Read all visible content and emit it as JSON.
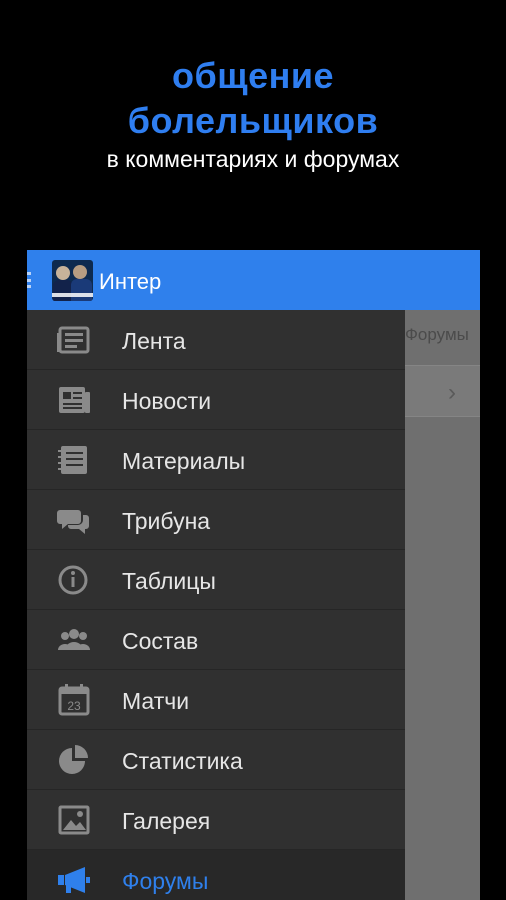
{
  "promo": {
    "line1": "общение",
    "line2": "болельщиков",
    "subtitle": "в комментариях и форумах"
  },
  "appbar": {
    "title": "Интер",
    "logo_icon": "team-logo"
  },
  "behind": {
    "tab_label": "Форумы",
    "chevron_icon": "chevron-right-icon"
  },
  "menu": [
    {
      "label": "Лента",
      "icon": "feed-icon"
    },
    {
      "label": "Новости",
      "icon": "news-icon"
    },
    {
      "label": "Материалы",
      "icon": "articles-icon"
    },
    {
      "label": "Трибуна",
      "icon": "chat-bubbles-icon"
    },
    {
      "label": "Таблицы",
      "icon": "info-icon"
    },
    {
      "label": "Состав",
      "icon": "people-icon"
    },
    {
      "label": "Матчи",
      "icon": "calendar-icon",
      "calendar_number": "23"
    },
    {
      "label": "Статистика",
      "icon": "pie-chart-icon"
    },
    {
      "label": "Галерея",
      "icon": "image-icon"
    },
    {
      "label": "Форумы",
      "icon": "megaphone-icon",
      "active": true
    }
  ],
  "colors": {
    "accent": "#2f80ec",
    "promo_title": "#2f7ef0",
    "drawer_bg": "#303030",
    "icon_gray": "#8a8a8a"
  }
}
